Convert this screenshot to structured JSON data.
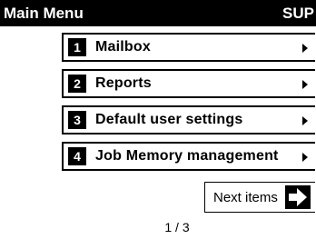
{
  "header": {
    "title": "Main Menu",
    "user": "SUP"
  },
  "menu": {
    "items": [
      {
        "number": "1",
        "label": "Mailbox",
        "icon": "chevron-right-icon"
      },
      {
        "number": "2",
        "label": "Reports",
        "icon": "chevron-right-icon"
      },
      {
        "number": "3",
        "label": "Default user settings",
        "icon": "chevron-right-icon"
      },
      {
        "number": "4",
        "label": "Job Memory management",
        "icon": "chevron-right-icon"
      }
    ]
  },
  "next": {
    "label": "Next items",
    "icon": "arrow-right-icon"
  },
  "pagination": {
    "text": "1 / 3"
  },
  "colors": {
    "header_bg": "#000000",
    "header_fg": "#ffffff",
    "background": "#ffffff",
    "border": "#000000"
  }
}
